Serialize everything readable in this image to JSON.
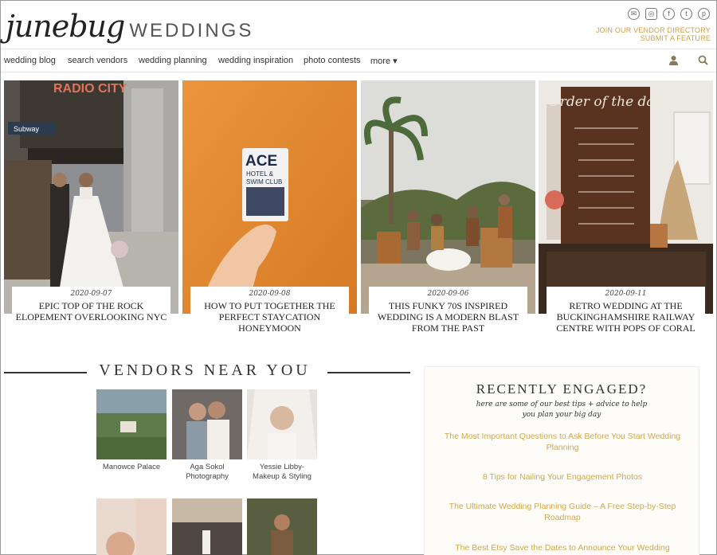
{
  "brand": {
    "script": "junebug",
    "word": "WEDDINGS"
  },
  "social": [
    "email-icon",
    "instagram-icon",
    "facebook-icon",
    "twitter-icon",
    "pinterest-icon"
  ],
  "header_links": {
    "join": "JOIN OUR VENDOR DIRECTORY",
    "submit": "SUBMIT A FEATURE"
  },
  "nav": {
    "items": [
      "wedding blog",
      "search vendors",
      "wedding planning",
      "wedding inspiration",
      "photo contests",
      "more ▾"
    ]
  },
  "cards": [
    {
      "date": "2020-09-07",
      "title": "EPIC TOP OF THE ROCK ELOPEMENT OVERLOOKING NYC",
      "sign": "RADIO CITY",
      "subway": "Subway"
    },
    {
      "date": "2020-09-08",
      "title": "HOW TO PUT TOGETHER THE PERFECT STAYCATION HONEYMOON",
      "card_lines": [
        "ACE",
        "HOTEL &",
        "SWIM CLUB"
      ]
    },
    {
      "date": "2020-09-06",
      "title": "THIS FUNKY 70S INSPIRED WEDDING IS A MODERN BLAST FROM THE PAST"
    },
    {
      "date": "2020-09-11",
      "title": "RETRO WEDDING AT THE BUCKINGHAMSHIRE RAILWAY CENTRE WITH POPS OF CORAL",
      "sign": "Order of the day"
    }
  ],
  "vendors": {
    "heading": "VENDORS NEAR YOU",
    "items": [
      {
        "name": "Manowce Palace"
      },
      {
        "name": "Aga Sokol Photography"
      },
      {
        "name": "Yessie Libby-Makeup & Styling"
      },
      {
        "name": ""
      },
      {
        "name": ""
      },
      {
        "name": ""
      }
    ]
  },
  "engaged": {
    "title": "RECENTLY ENGAGED?",
    "subtitle": "here are some of our best tips + advice to help you plan your big day",
    "links": [
      "The Most Important Questions to Ask Before You Start Wedding Planning",
      "8 Tips for Nailing Your Engagement Photos",
      "The Ultimate Wedding Planning Guide – A Free Step-by-Step Roadmap",
      "The Best Etsy Save the Dates to Announce Your Wedding"
    ]
  },
  "colors": {
    "accent": "#d2a84e",
    "text": "#333333"
  }
}
